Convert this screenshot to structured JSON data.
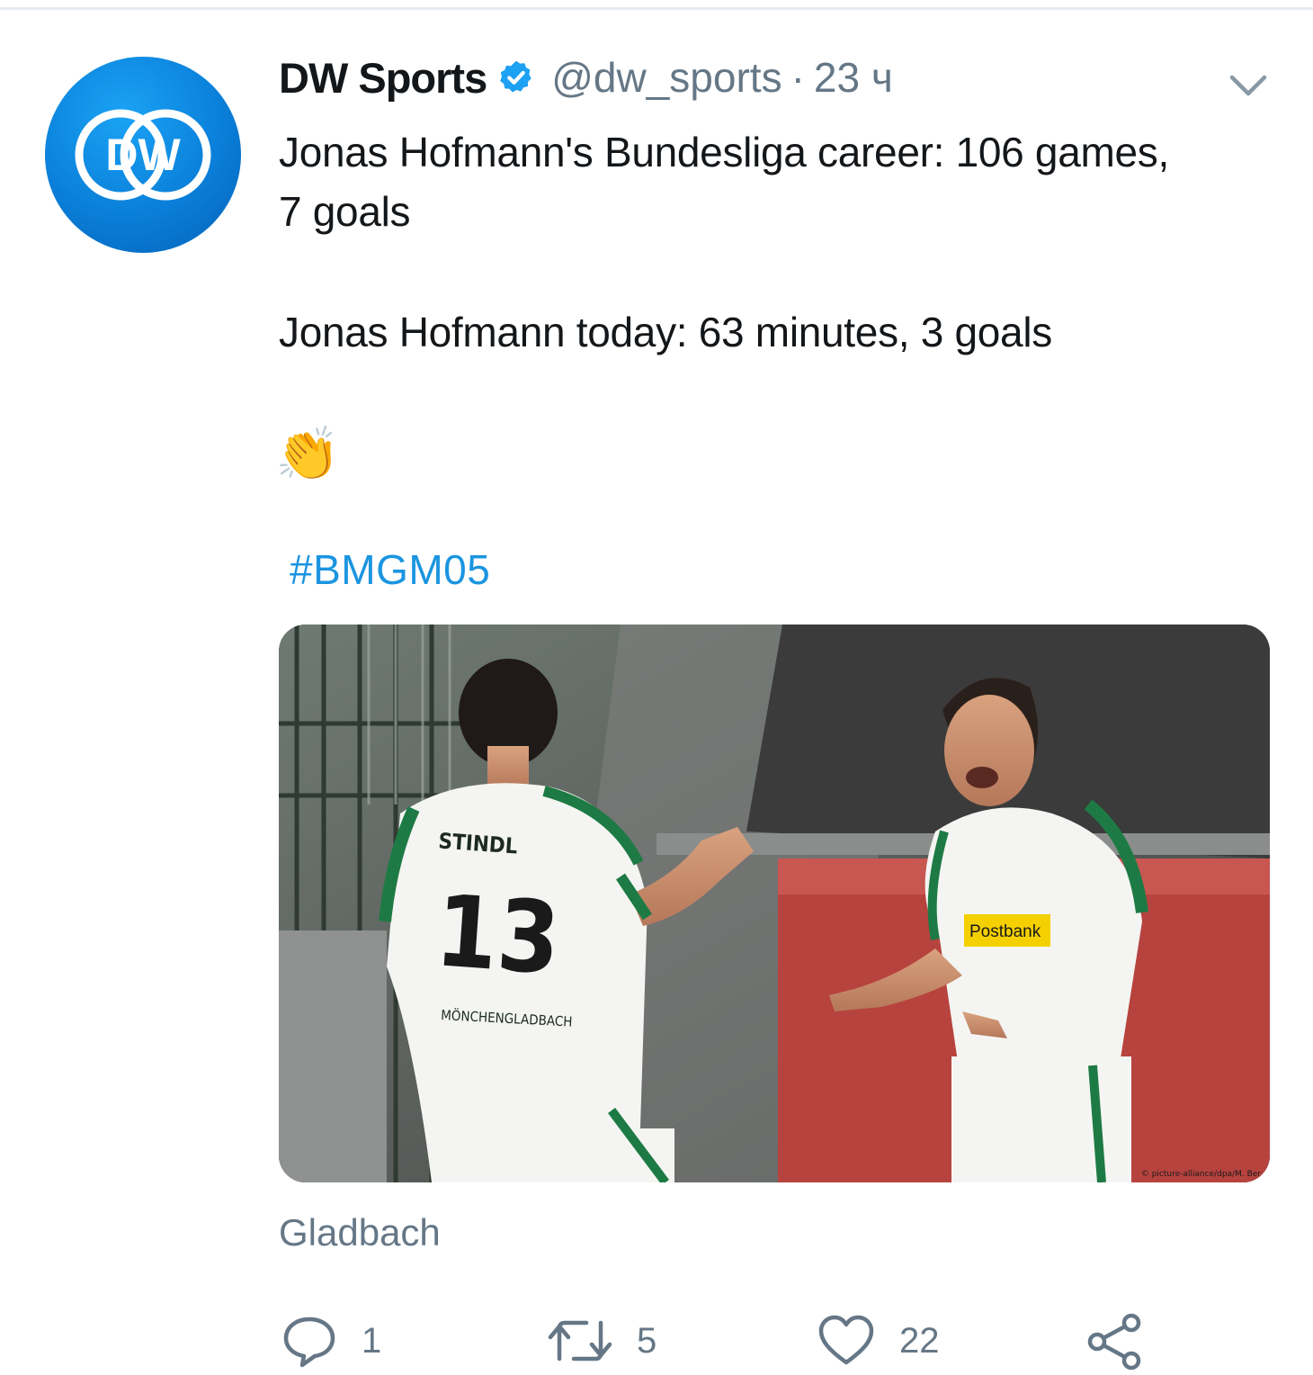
{
  "tweet": {
    "author_name": "DW Sports",
    "handle": "@dw_sports",
    "separator": "·",
    "time": "23 ч",
    "text_lines": [
      "Jonas Hofmann's Bundesliga career: 106 games,",
      "7 goals",
      "Jonas Hofmann today: 63 minutes, 3 goals"
    ],
    "emoji": "👏",
    "hashtag": "#BMGM05",
    "caption": "Gladbach"
  },
  "avatar": {
    "logo_text": "DW"
  },
  "photo": {
    "credit": "© picture-alliance/dpa/M. Ber",
    "player_left": {
      "name": "STINDL",
      "number": "13",
      "club": "MÖNCHENGLADBACH"
    },
    "player_right": {
      "sponsor": "Postbank"
    }
  },
  "actions": {
    "reply_count": "1",
    "retweet_count": "5",
    "like_count": "22"
  },
  "colors": {
    "link": "#1b95e0",
    "secondary_text": "#657786",
    "verified_badge": "#1da1f2",
    "avatar_blue": "#0a7fd9"
  }
}
